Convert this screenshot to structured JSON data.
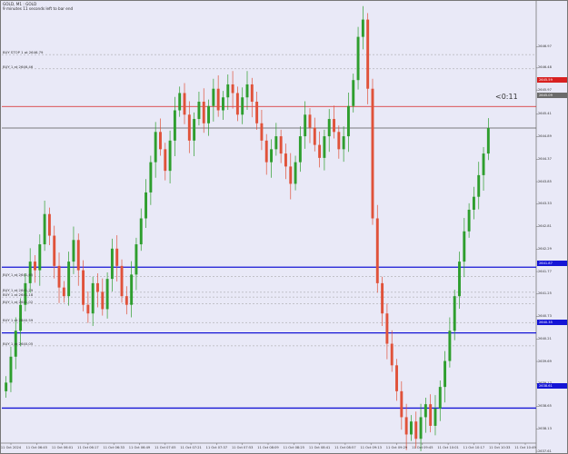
{
  "header": {
    "symbol_line": "GOLD, M1 : GOLD",
    "timer_line": "9 minutes 11 seconds left to bar end"
  },
  "countdown": "<0:11",
  "colors": {
    "background": "#e9e9f7",
    "bull": "#2e9e2e",
    "bear": "#e0523a",
    "level_line": "#1515d6",
    "current_price_line": "#555555",
    "sell_stop_line": "#d82020",
    "buy_stop_line": "#9a9a9a",
    "order_line": "#9a9a9a"
  },
  "price_tags": {
    "current": "2645.09",
    "red": "2645.59",
    "blue_top": "2641.87",
    "blue_mid": "2640.35",
    "blue_bottom": "2638.61"
  },
  "order_labels": [
    {
      "text": "BUY STOP 1 at 2646.79",
      "price": 2646.79
    },
    {
      "text": "BUY 1 at 2646.46",
      "price": 2646.46
    },
    {
      "text": "BUY 1 at 2641.65",
      "price": 2641.65
    },
    {
      "text": "BUY 1 at 2641.29",
      "price": 2641.29
    },
    {
      "text": "BUY 1 at 2641.18",
      "price": 2641.18
    },
    {
      "text": "BUY 1 at 2641.02",
      "price": 2641.02
    },
    {
      "text": "BUY 1 at 2640.59",
      "price": 2640.59
    },
    {
      "text": "BUY 1 at 2640.05",
      "price": 2640.05
    }
  ],
  "chart_data": {
    "type": "candlestick",
    "y_axis": {
      "min": 2637.8,
      "max": 2647.99,
      "ticks": [
        "2646.97",
        "2646.48",
        "2645.97",
        "2645.41",
        "2644.89",
        "2644.37",
        "2643.85",
        "2643.33",
        "2642.81",
        "2642.29",
        "2641.77",
        "2641.25",
        "2640.73",
        "2640.21",
        "2639.69",
        "2639.17",
        "2638.65",
        "2638.13",
        "2637.61"
      ]
    },
    "x_axis": {
      "ticks": [
        "11 Oct 2024",
        "11 Oct 06:45",
        "11 Oct 06:01",
        "11 Oct 06:17",
        "11 Oct 06:33",
        "11 Oct 06:49",
        "11 Oct 07:05",
        "11 Oct 07:21",
        "11 Oct 07:37",
        "11 Oct 07:53",
        "11 Oct 08:09",
        "11 Oct 08:25",
        "11 Oct 08:41",
        "11 Oct 08:57",
        "11 Oct 09:13",
        "11 Oct 09:29",
        "11 Oct 09:45",
        "11 Oct 10:01",
        "11 Oct 10:17",
        "11 Oct 10:33",
        "11 Oct 10:49"
      ]
    },
    "levels": [
      {
        "price": 2645.09,
        "style": "solid-gray"
      },
      {
        "price": 2645.59,
        "style": "solid-red"
      },
      {
        "price": 2641.87,
        "style": "solid-blue"
      },
      {
        "price": 2640.35,
        "style": "solid-blue"
      },
      {
        "price": 2638.61,
        "style": "solid-blue"
      }
    ],
    "closes": [
      2639.2,
      2639.8,
      2640.4,
      2641.0,
      2641.5,
      2642.0,
      2641.8,
      2642.4,
      2643.1,
      2642.6,
      2641.9,
      2641.4,
      2641.2,
      2642.0,
      2642.5,
      2641.8,
      2641.0,
      2640.8,
      2641.5,
      2641.3,
      2640.9,
      2641.6,
      2642.3,
      2641.9,
      2641.2,
      2641.0,
      2641.7,
      2642.4,
      2643.0,
      2643.6,
      2644.3,
      2645.0,
      2644.6,
      2644.1,
      2644.8,
      2645.5,
      2645.9,
      2645.4,
      2644.8,
      2645.3,
      2645.7,
      2645.2,
      2645.6,
      2646.0,
      2645.5,
      2645.8,
      2646.1,
      2645.9,
      2645.4,
      2645.8,
      2646.1,
      2645.7,
      2645.2,
      2644.8,
      2644.3,
      2644.6,
      2644.9,
      2644.5,
      2644.2,
      2643.8,
      2644.3,
      2644.9,
      2645.4,
      2645.1,
      2644.7,
      2644.4,
      2644.9,
      2645.3,
      2645.0,
      2644.6,
      2644.9,
      2645.6,
      2646.2,
      2647.2,
      2647.6,
      2646.0,
      2643.0,
      2641.5,
      2640.8,
      2640.1,
      2639.6,
      2639.0,
      2638.4,
      2638.0,
      2638.3,
      2637.9,
      2638.4,
      2638.7,
      2638.2,
      2638.6,
      2639.1,
      2639.7,
      2640.4,
      2641.2,
      2642.0,
      2642.7,
      2643.2,
      2643.5,
      2644.0,
      2644.5,
      2645.09
    ]
  }
}
